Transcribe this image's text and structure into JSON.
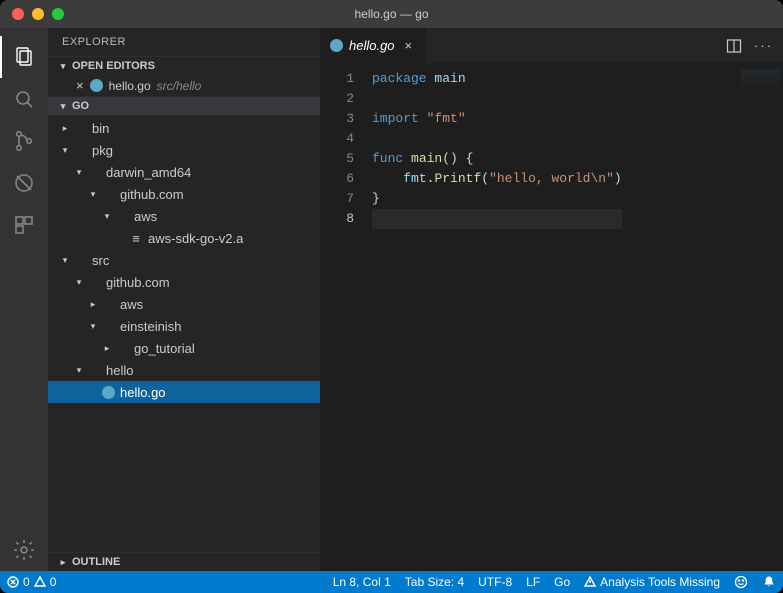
{
  "title": "hello.go — go",
  "sidebar": {
    "title": "EXPLORER",
    "openEditorsHeader": "OPEN EDITORS",
    "openEditors": [
      {
        "name": "hello.go",
        "path": "src/hello"
      }
    ],
    "folderHeader": "GO",
    "outlineHeader": "OUTLINE",
    "tree": [
      {
        "label": "bin",
        "depth": 0,
        "kind": "folder",
        "expanded": false
      },
      {
        "label": "pkg",
        "depth": 0,
        "kind": "folder",
        "expanded": true
      },
      {
        "label": "darwin_amd64",
        "depth": 1,
        "kind": "folder",
        "expanded": true
      },
      {
        "label": "github.com",
        "depth": 2,
        "kind": "folder",
        "expanded": true
      },
      {
        "label": "aws",
        "depth": 3,
        "kind": "folder",
        "expanded": true
      },
      {
        "label": "aws-sdk-go-v2.a",
        "depth": 4,
        "kind": "file"
      },
      {
        "label": "src",
        "depth": 0,
        "kind": "folder",
        "expanded": true
      },
      {
        "label": "github.com",
        "depth": 1,
        "kind": "folder",
        "expanded": true
      },
      {
        "label": "aws",
        "depth": 2,
        "kind": "folder",
        "expanded": false
      },
      {
        "label": "einsteinish",
        "depth": 2,
        "kind": "folder",
        "expanded": true
      },
      {
        "label": "go_tutorial",
        "depth": 3,
        "kind": "folder",
        "expanded": false
      },
      {
        "label": "hello",
        "depth": 1,
        "kind": "folder",
        "expanded": true
      },
      {
        "label": "hello.go",
        "depth": 2,
        "kind": "gofile",
        "selected": true
      }
    ]
  },
  "tab": {
    "name": "hello.go"
  },
  "code": {
    "lines": [
      {
        "n": 1,
        "segments": [
          {
            "t": "package ",
            "c": "kw"
          },
          {
            "t": "main",
            "c": "id"
          }
        ]
      },
      {
        "n": 2,
        "segments": []
      },
      {
        "n": 3,
        "segments": [
          {
            "t": "import ",
            "c": "kw"
          },
          {
            "t": "\"fmt\"",
            "c": "str"
          }
        ]
      },
      {
        "n": 4,
        "segments": []
      },
      {
        "n": 5,
        "segments": [
          {
            "t": "func ",
            "c": "kw"
          },
          {
            "t": "main",
            "c": "fn"
          },
          {
            "t": "() {",
            "c": ""
          }
        ]
      },
      {
        "n": 6,
        "segments": [
          {
            "t": "    ",
            "c": ""
          },
          {
            "t": "fmt",
            "c": "id"
          },
          {
            "t": ".",
            "c": ""
          },
          {
            "t": "Printf",
            "c": "fn"
          },
          {
            "t": "(",
            "c": ""
          },
          {
            "t": "\"hello, world\\n\"",
            "c": "str"
          },
          {
            "t": ")",
            "c": ""
          }
        ]
      },
      {
        "n": 7,
        "segments": [
          {
            "t": "}",
            "c": ""
          }
        ]
      },
      {
        "n": 8,
        "segments": [],
        "current": true
      }
    ]
  },
  "status": {
    "errors": "0",
    "warnings": "0",
    "position": "Ln 8, Col 1",
    "tabSize": "Tab Size: 4",
    "encoding": "UTF-8",
    "eol": "LF",
    "lang": "Go",
    "analysis": "Analysis Tools Missing"
  }
}
